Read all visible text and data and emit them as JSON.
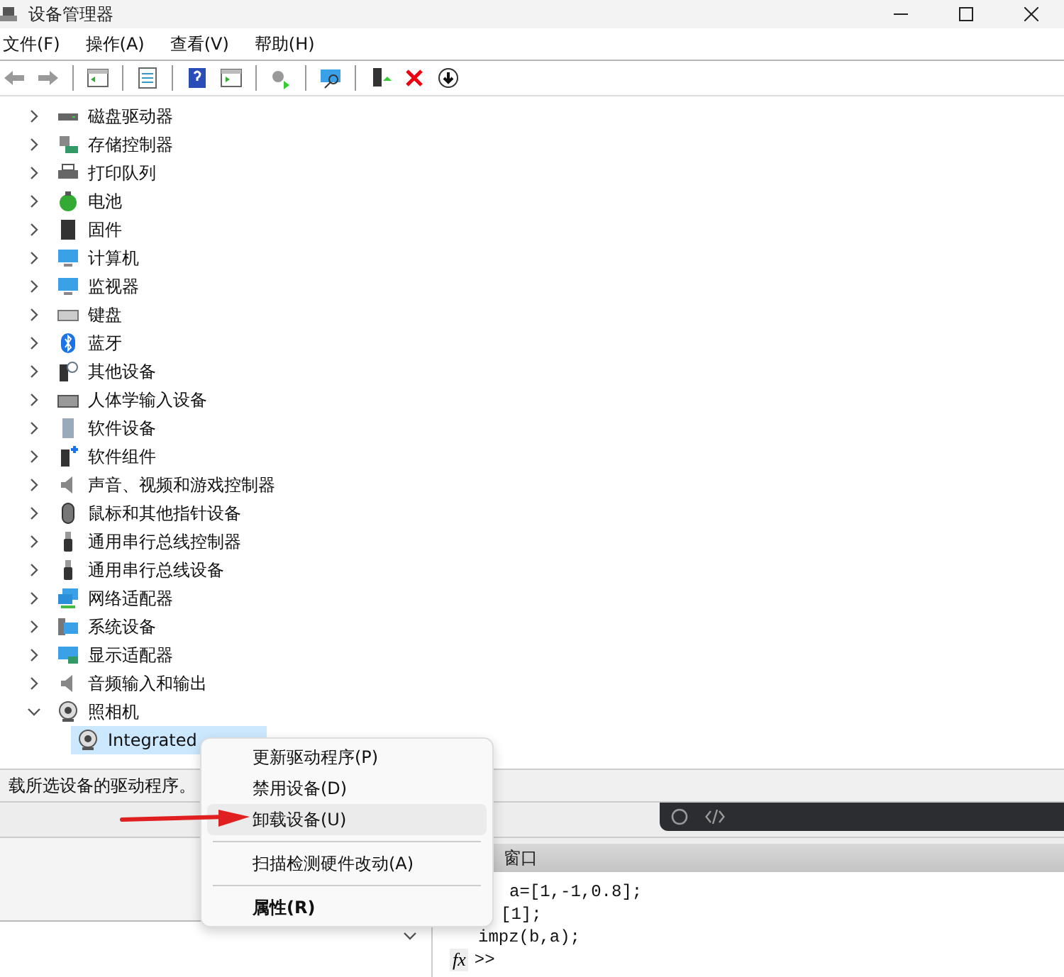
{
  "window": {
    "title": "设备管理器"
  },
  "menu": [
    "文件(F)",
    "操作(A)",
    "查看(V)",
    "帮助(H)"
  ],
  "tree": [
    {
      "label": "磁盘驱动器",
      "expanded": false
    },
    {
      "label": "存储控制器",
      "expanded": false
    },
    {
      "label": "打印队列",
      "expanded": false
    },
    {
      "label": "电池",
      "expanded": false
    },
    {
      "label": "固件",
      "expanded": false
    },
    {
      "label": "计算机",
      "expanded": false
    },
    {
      "label": "监视器",
      "expanded": false
    },
    {
      "label": "键盘",
      "expanded": false
    },
    {
      "label": "蓝牙",
      "expanded": false
    },
    {
      "label": "其他设备",
      "expanded": false
    },
    {
      "label": "人体学输入设备",
      "expanded": false
    },
    {
      "label": "软件设备",
      "expanded": false
    },
    {
      "label": "软件组件",
      "expanded": false
    },
    {
      "label": "声音、视频和游戏控制器",
      "expanded": false
    },
    {
      "label": "鼠标和其他指针设备",
      "expanded": false
    },
    {
      "label": "通用串行总线控制器",
      "expanded": false
    },
    {
      "label": "通用串行总线设备",
      "expanded": false
    },
    {
      "label": "网络适配器",
      "expanded": false
    },
    {
      "label": "系统设备",
      "expanded": false
    },
    {
      "label": "显示适配器",
      "expanded": false
    },
    {
      "label": "音频输入和输出",
      "expanded": false
    },
    {
      "label": "照相机",
      "expanded": true,
      "children": [
        {
          "label": "Integrated",
          "selected": true
        }
      ]
    }
  ],
  "status_bar": "载所选设备的驱动程序。",
  "context_menu": [
    {
      "kind": "item",
      "label": "更新驱动程序(P)",
      "selected": false
    },
    {
      "kind": "item",
      "label": "禁用设备(D)",
      "selected": false
    },
    {
      "kind": "item",
      "label": "卸载设备(U)",
      "selected": true
    },
    {
      "kind": "separator"
    },
    {
      "kind": "item",
      "label": "扫描检测硬件改动(A)",
      "selected": false
    },
    {
      "kind": "separator"
    },
    {
      "kind": "item",
      "label": "属性(R)",
      "selected": false,
      "default": true
    }
  ],
  "command_window": {
    "title": "窗口",
    "lines": [
      "a=[1,-1,0.8];",
      "[1];",
      "impz(b,a);"
    ],
    "fx": "fx",
    "prompt": ">>"
  }
}
